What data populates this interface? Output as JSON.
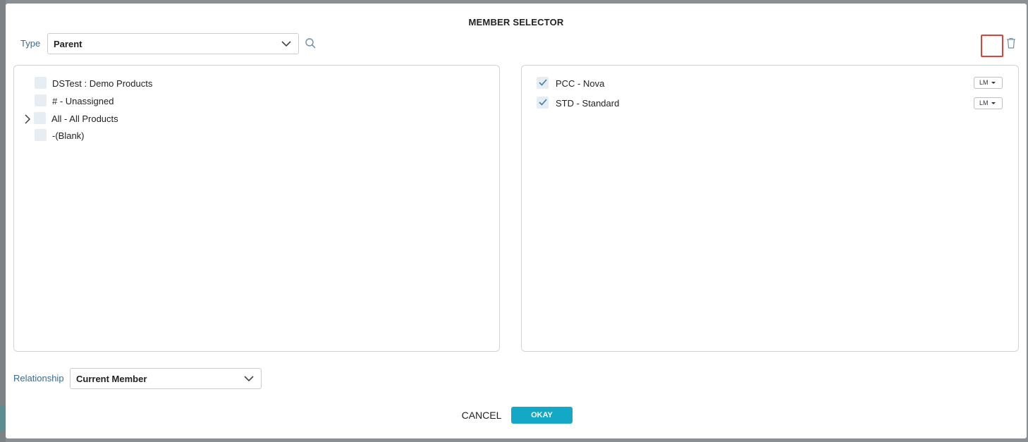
{
  "dialog": {
    "title": "MEMBER SELECTOR"
  },
  "type_field": {
    "label": "Type",
    "value": "Parent"
  },
  "left_tree": {
    "items": [
      {
        "label": "DSTest : Demo Products",
        "checked": false,
        "expandable": false
      },
      {
        "label": "# - Unassigned",
        "checked": false,
        "expandable": false
      },
      {
        "label": "All - All Products",
        "checked": false,
        "expandable": true
      },
      {
        "label": "-(Blank)",
        "checked": false,
        "expandable": false
      }
    ]
  },
  "selected": {
    "items": [
      {
        "label": "PCC - Nova",
        "checked": true,
        "badge": "LM"
      },
      {
        "label": "STD - Standard",
        "checked": true,
        "badge": "LM"
      }
    ]
  },
  "relationship_field": {
    "label": "Relationship",
    "value": "Current Member"
  },
  "footer": {
    "cancel_label": "CANCEL",
    "okay_label": "OKAY"
  },
  "colors": {
    "accent": "#13a8c5",
    "label_blue": "#3b6a8f",
    "highlight": "#e0403a"
  },
  "icons": {
    "search": "search-icon",
    "trash": "trash-icon",
    "chevron": "chevron-down-icon",
    "expand": "chevron-right-icon",
    "check": "check-icon"
  }
}
